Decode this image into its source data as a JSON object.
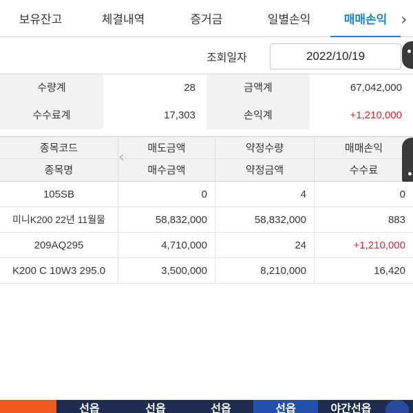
{
  "tabs": [
    {
      "label": "보유잔고"
    },
    {
      "label": "체결내역"
    },
    {
      "label": "증거금"
    },
    {
      "label": "일별손익"
    },
    {
      "label": "매매손익"
    }
  ],
  "tab_arrow": "›",
  "active_tab": "매매손익",
  "query": {
    "label": "조회일자",
    "date": "2022/10/19"
  },
  "summary": {
    "qty_label": "수량계",
    "qty_value": "28",
    "amount_label": "금액계",
    "amount_value": "67,042,000",
    "fee_label": "수수료계",
    "fee_value": "17,303",
    "pnl_label": "손익계",
    "pnl_value": "+1,210,000"
  },
  "columns": {
    "row1": [
      "종목코드",
      "매도금액",
      "약정수량",
      "매매손익"
    ],
    "row2": [
      "종목명",
      "매수금액",
      "약정금액",
      "수수료"
    ]
  },
  "rows": [
    {
      "name": "105SB",
      "sell_or_buy": "0",
      "qty_or_amount": "4",
      "pnl_or_fee": "0",
      "red": false
    },
    {
      "name": "미니K200 22년 11월물",
      "sell_or_buy": "58,832,000",
      "qty_or_amount": "58,832,000",
      "pnl_or_fee": "883",
      "red": false
    },
    {
      "name": "209AQ295",
      "sell_or_buy": "4,710,000",
      "qty_or_amount": "24",
      "pnl_or_fee": "+1,210,000",
      "red": true
    },
    {
      "name": "K200 C 10W3 295.0",
      "sell_or_buy": "3,500,000",
      "qty_or_amount": "8,210,000",
      "pnl_or_fee": "16,420",
      "red": false
    }
  ],
  "bottom_bar": {
    "items": [
      "선옵",
      "선옵",
      "선옵",
      "선옵",
      "야간선옵"
    ],
    "selected_index": 3
  },
  "colors": {
    "accent": "#1a82d6",
    "profit_red": "#e0202a",
    "bottom_bar": "#1e2c4f",
    "bottom_accent": "#f05a1a"
  }
}
